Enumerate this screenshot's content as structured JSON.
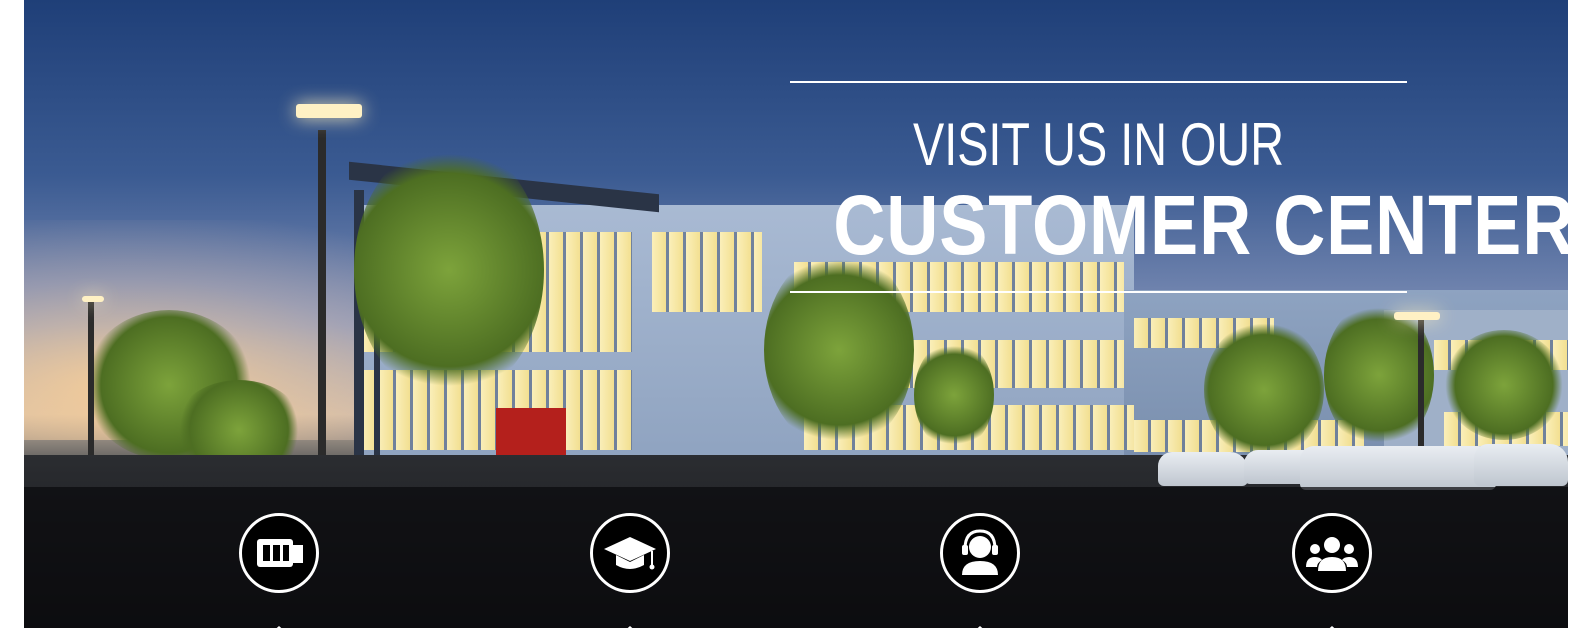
{
  "hero": {
    "heading_line1": "VISIT US IN OUR",
    "heading_line2": "CUSTOMER CENTER"
  },
  "nav": {
    "items": [
      {
        "icon": "machine-icon"
      },
      {
        "icon": "graduation-cap-icon"
      },
      {
        "icon": "headset-support-icon"
      },
      {
        "icon": "people-group-icon"
      }
    ]
  },
  "colors": {
    "text": "#ffffff",
    "nav_bar": "#0a0a0c",
    "sky_top": "#1f3f78"
  }
}
